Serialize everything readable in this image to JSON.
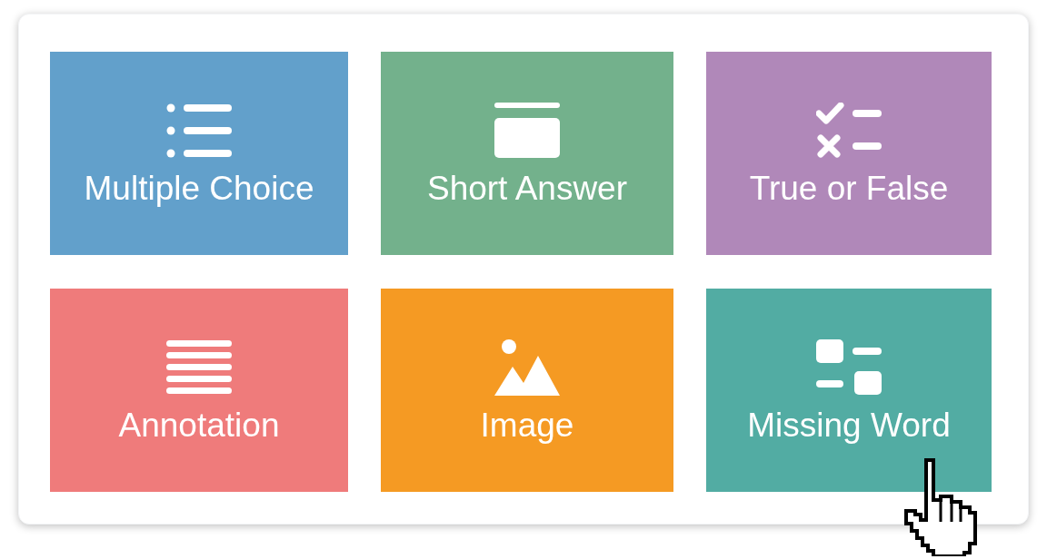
{
  "tiles": [
    {
      "label": "Multiple Choice",
      "color": "#62a0cb",
      "kind": "list"
    },
    {
      "label": "Short Answer",
      "color": "#73b18c",
      "kind": "card"
    },
    {
      "label": "True or False",
      "color": "#b088b9",
      "kind": "checklist"
    },
    {
      "label": "Annotation",
      "color": "#ef7b7b",
      "kind": "lines"
    },
    {
      "label": "Image",
      "color": "#f59a23",
      "kind": "image"
    },
    {
      "label": "Missing Word",
      "color": "#52aca3",
      "kind": "blocks"
    }
  ]
}
